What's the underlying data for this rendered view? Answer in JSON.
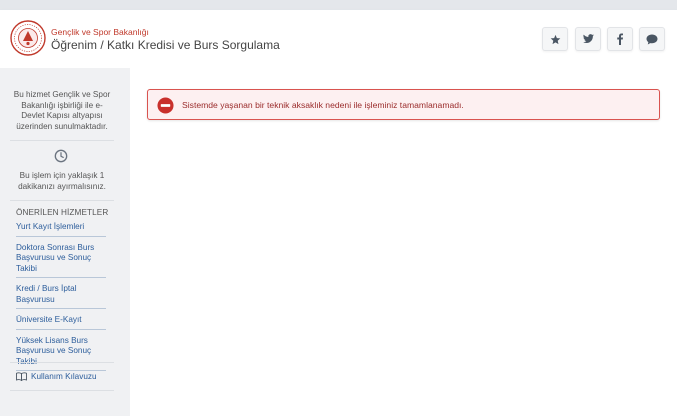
{
  "header": {
    "org_name": "Gençlik ve Spor Bakanlığı",
    "page_title": "Öğrenim / Katkı Kredisi ve Burs Sorgulama",
    "buttons": [
      {
        "name": "favorite",
        "icon": "star-icon"
      },
      {
        "name": "twitter",
        "icon": "twitter-icon"
      },
      {
        "name": "facebook",
        "icon": "facebook-icon"
      },
      {
        "name": "feedback",
        "icon": "speech-bubble-icon"
      }
    ]
  },
  "sidebar": {
    "info_text": "Bu hizmet Gençlik ve Spor Bakanlığı işbirliği ile e-Devlet Kapısı altyapısı üzerinden sunulmaktadır.",
    "time_text": "Bu işlem için yaklaşık 1 dakikanızı ayırmalısınız.",
    "services_heading": "ÖNERİLEN HİZMETLER",
    "services": [
      "Yurt Kayıt İşlemleri",
      "Doktora Sonrası Burs Başvurusu ve Sonuç Takibi",
      "Kredi / Burs İptal Başvurusu",
      "Üniversite E-Kayıt",
      "Yüksek Lisans Burs Başvurusu ve Sonuç Takibi"
    ],
    "guide_label": "Kullanım Kılavuzu"
  },
  "alert": {
    "message": "Sistemde yaşanan bir teknik aksaklık nedeni ile işleminiz tamamlanamadı.",
    "color": "#d9534f"
  },
  "colors": {
    "brand_red": "#c0392b",
    "link_blue": "#2c5d9b"
  }
}
